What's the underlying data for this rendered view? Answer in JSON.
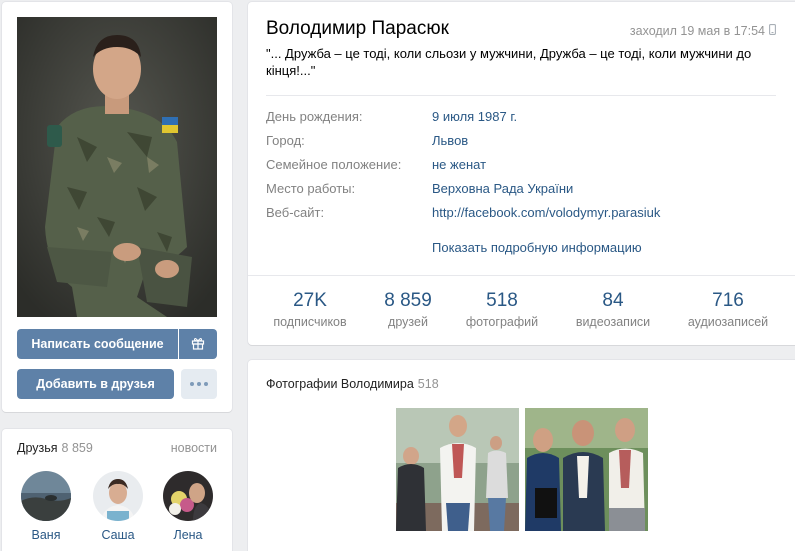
{
  "profile": {
    "name": "Володимир Парасюк",
    "last_seen": "заходил 19 мая в 17:54",
    "status": "\"... Дружба – це тоді, коли сльози у мужчини, Дружба – це тоді, коли мужчини до кінця!...\"",
    "info": [
      {
        "label": "День рождения:",
        "value": "9 июля 1987 г."
      },
      {
        "label": "Город:",
        "value": "Львов"
      },
      {
        "label": "Семейное положение:",
        "value": "не женат"
      },
      {
        "label": "Место работы:",
        "value": "Верховна Рада України"
      },
      {
        "label": "Веб-сайт:",
        "value": "http://facebook.com/volodymyr.parasiuk"
      }
    ],
    "more_info": "Показать подробную информацию",
    "counters": [
      {
        "num": "27K",
        "label": "подписчиков"
      },
      {
        "num": "8 859",
        "label": "друзей"
      },
      {
        "num": "518",
        "label": "фотографий"
      },
      {
        "num": "84",
        "label": "видеозаписи"
      },
      {
        "num": "716",
        "label": "аудиозаписей"
      }
    ]
  },
  "actions": {
    "message": "Написать сообщение",
    "add_friend": "Добавить в друзья",
    "gift_icon": "gift-icon",
    "more_icon": "more-dots-icon"
  },
  "friends": {
    "title": "Друзья",
    "count": "8 859",
    "news": "новости",
    "items": [
      {
        "name": "Ваня"
      },
      {
        "name": "Саша"
      },
      {
        "name": "Лена"
      }
    ]
  },
  "photos": {
    "title": "Фотографии Володимира",
    "count": "518"
  },
  "colors": {
    "accent": "#5e81a8",
    "link": "#2a5885",
    "background": "#edeef0"
  }
}
